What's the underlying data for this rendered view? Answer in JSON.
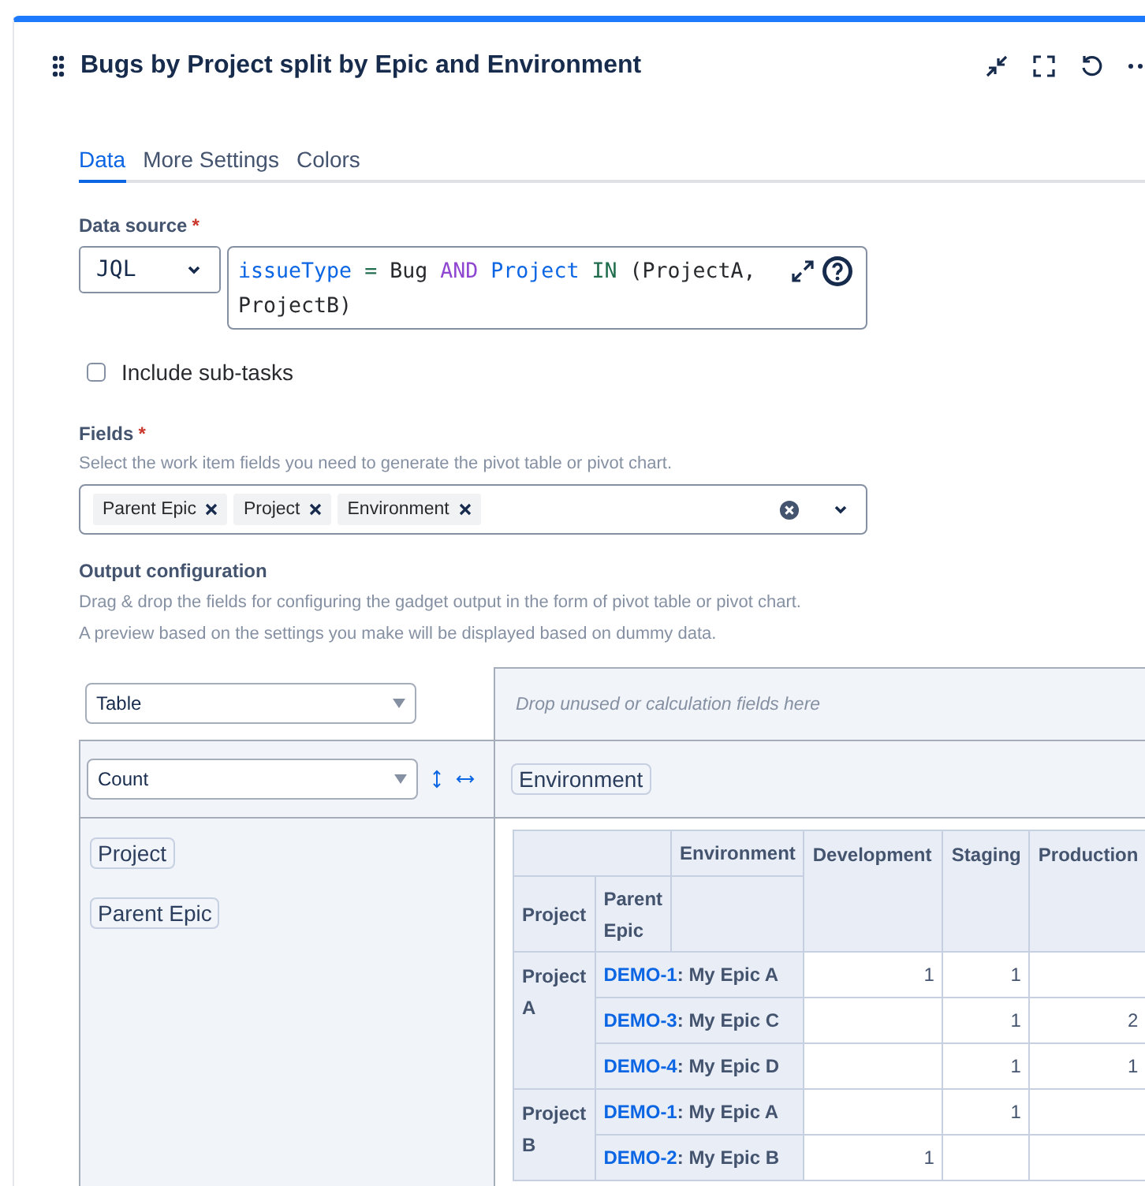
{
  "widget": {
    "title": "Bugs by Project split by Epic and Environment"
  },
  "tabs": [
    {
      "label": "Data",
      "selected": true
    },
    {
      "label": "More Settings",
      "selected": false
    },
    {
      "label": "Colors",
      "selected": false
    }
  ],
  "data_source": {
    "label": "Data source",
    "required_mark": "*",
    "type_value": "JQL",
    "query_tokens": [
      {
        "text": "issueType",
        "kind": "field"
      },
      {
        "text": " = ",
        "kind": "operator"
      },
      {
        "text": "Bug ",
        "kind": "plain"
      },
      {
        "text": "AND",
        "kind": "keyword"
      },
      {
        "text": " Project",
        "kind": "field"
      },
      {
        "text": " IN ",
        "kind": "operator"
      },
      {
        "text": "(ProjectA, ProjectB)",
        "kind": "plain"
      }
    ]
  },
  "include_subtasks": {
    "label": "Include sub-tasks",
    "checked": false
  },
  "fields": {
    "label": "Fields",
    "required_mark": "*",
    "hint": "Select the work item fields you need to generate the pivot table or pivot chart.",
    "tags": [
      "Parent Epic",
      "Project",
      "Environment"
    ]
  },
  "output": {
    "label": "Output configuration",
    "hints": [
      "Drag & drop the fields for configuring the gadget output in the form of pivot table or pivot chart.",
      "A preview based on the settings you make will be displayed based on dummy data."
    ],
    "renderer": "Table",
    "aggregator": "Count",
    "drop_zone_placeholder": "Drop unused or calculation fields here",
    "column_fields": [
      "Environment"
    ],
    "row_fields": [
      "Project",
      "Parent Epic"
    ],
    "table": {
      "column_field": "Environment",
      "row_headers": [
        "Project",
        "Parent Epic"
      ],
      "columns": [
        "Development",
        "Staging",
        "Production"
      ],
      "groups": [
        {
          "project": "Project A",
          "rows": [
            {
              "key": "DEMO-1",
              "name": ": My Epic A",
              "cells": [
                {
                  "value": "1"
                },
                {
                  "value": "1"
                },
                {}
              ]
            },
            {
              "key": "DEMO-3",
              "name": ": My Epic C",
              "cells": [
                {},
                {
                  "value": "1"
                },
                {
                  "value": "2"
                }
              ]
            },
            {
              "key": "DEMO-4",
              "name": ": My Epic D",
              "cells": [
                {},
                {
                  "value": "1"
                },
                {
                  "value": "1"
                }
              ]
            }
          ]
        },
        {
          "project": "Project B",
          "rows": [
            {
              "key": "DEMO-1",
              "name": ": My Epic A",
              "cells": [
                {},
                {
                  "value": "1"
                },
                {}
              ]
            },
            {
              "key": "DEMO-2",
              "name": ": My Epic B",
              "cells": [
                {
                  "value": "1"
                },
                {},
                {}
              ]
            }
          ]
        }
      ]
    }
  }
}
